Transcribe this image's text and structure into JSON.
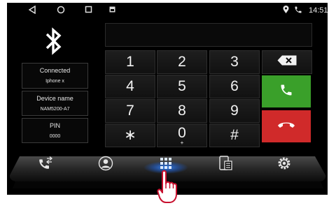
{
  "status_bar": {
    "time": "14:51",
    "nav_icons": [
      "back-icon",
      "home-icon",
      "recents-icon"
    ],
    "notification_icon": "image-notification-icon",
    "status_icons": [
      "location-icon",
      "phone-call-icon"
    ]
  },
  "bluetooth": {
    "icon": "bluetooth-icon",
    "connected_label": "Connected",
    "connected_value": "Iphone x",
    "device_name_label": "Device name",
    "device_name_value": "NAM5200-A7",
    "pin_label": "PIN",
    "pin_value": "0000"
  },
  "dialer": {
    "display_value": "",
    "keys": [
      {
        "label": "1",
        "sub": ""
      },
      {
        "label": "2",
        "sub": ""
      },
      {
        "label": "3",
        "sub": ""
      },
      {
        "label": "4",
        "sub": ""
      },
      {
        "label": "5",
        "sub": ""
      },
      {
        "label": "6",
        "sub": ""
      },
      {
        "label": "7",
        "sub": ""
      },
      {
        "label": "8",
        "sub": ""
      },
      {
        "label": "9",
        "sub": ""
      },
      {
        "label": "∗",
        "sub": ""
      },
      {
        "label": "0",
        "sub": "+"
      },
      {
        "label": "#",
        "sub": ""
      }
    ],
    "backspace_icon": "backspace-icon",
    "call_icon": "phone-icon",
    "hangup_icon": "hang-up-icon",
    "call_color": "#3aa02a",
    "hangup_color": "#d02a2a"
  },
  "dock": {
    "items": [
      {
        "icon": "call-transfer-icon"
      },
      {
        "icon": "contacts-icon"
      },
      {
        "icon": "dialpad-icon",
        "active": true
      },
      {
        "icon": "phone-book-icon"
      },
      {
        "icon": "settings-icon"
      }
    ],
    "active_color": "#2f7fe0"
  },
  "annotation": {
    "icon": "tap-hand-icon",
    "color": "#c8102e"
  }
}
